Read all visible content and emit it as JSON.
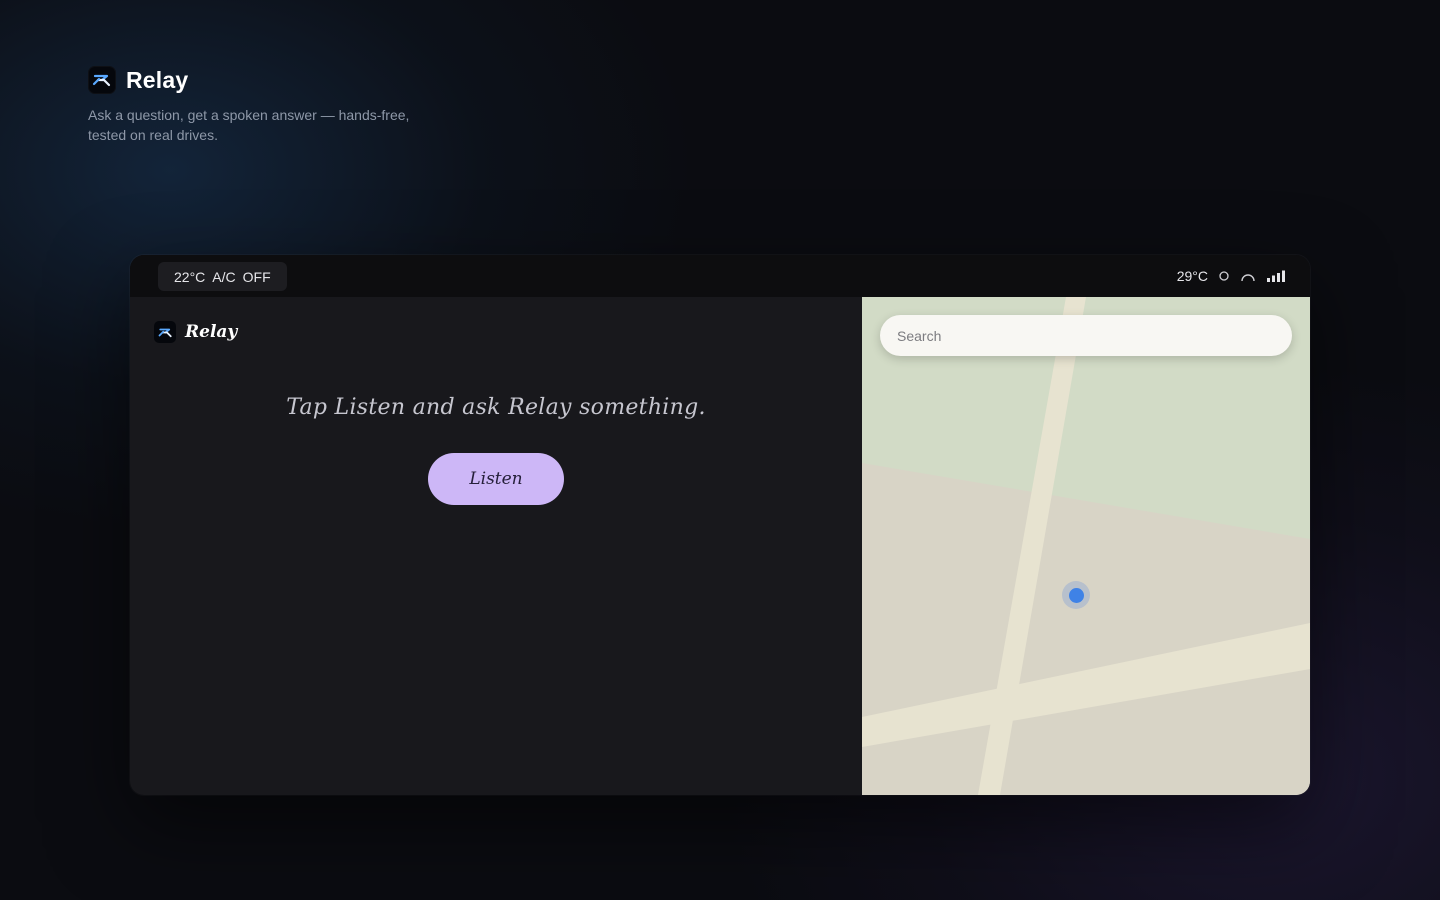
{
  "header": {
    "app_name": "Relay",
    "tagline": "Ask a question, get a spoken answer — hands-free, tested on real drives.",
    "logo_icon": "relay-logo-icon"
  },
  "status_bar": {
    "climate": {
      "temperature": "22°C",
      "ac_label": "A/C",
      "ac_state": "OFF"
    },
    "outside_temperature": "29°C",
    "icons": [
      "circle-status-icon",
      "arc-status-icon",
      "signal-bars-icon"
    ]
  },
  "assistant": {
    "app_name": "Relay",
    "prompt": "Tap Listen and ask Relay something.",
    "listen_label": "Listen"
  },
  "map": {
    "search_placeholder": "Search",
    "location_marker": "current-location-dot"
  },
  "colors": {
    "listen_button": "#cdb7f7",
    "location_dot": "#3f82e6",
    "map_land": "#d8d4c6",
    "map_park": "#d2dbc6",
    "map_road": "#e7e3d0"
  }
}
